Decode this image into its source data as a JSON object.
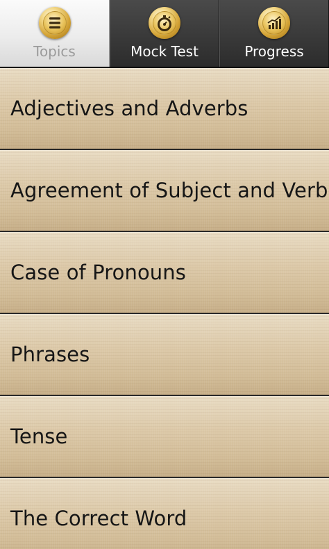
{
  "tabs": [
    {
      "label": "Topics",
      "icon": "list-icon",
      "active": true
    },
    {
      "label": "Mock Test",
      "icon": "stopwatch-icon",
      "active": false
    },
    {
      "label": "Progress",
      "icon": "bar-chart-icon",
      "active": false
    }
  ],
  "topics": [
    "Adjectives and Adverbs",
    "Agreement of Subject and Verb",
    "Case of Pronouns",
    "Phrases",
    "Tense",
    "The Correct Word"
  ],
  "colors": {
    "icon_gold": "#d4a437",
    "icon_dark": "#3a2a10",
    "list_bg": "#ddcaaa",
    "tab_inactive": "#3b3b3b",
    "tab_active": "#ececec"
  }
}
